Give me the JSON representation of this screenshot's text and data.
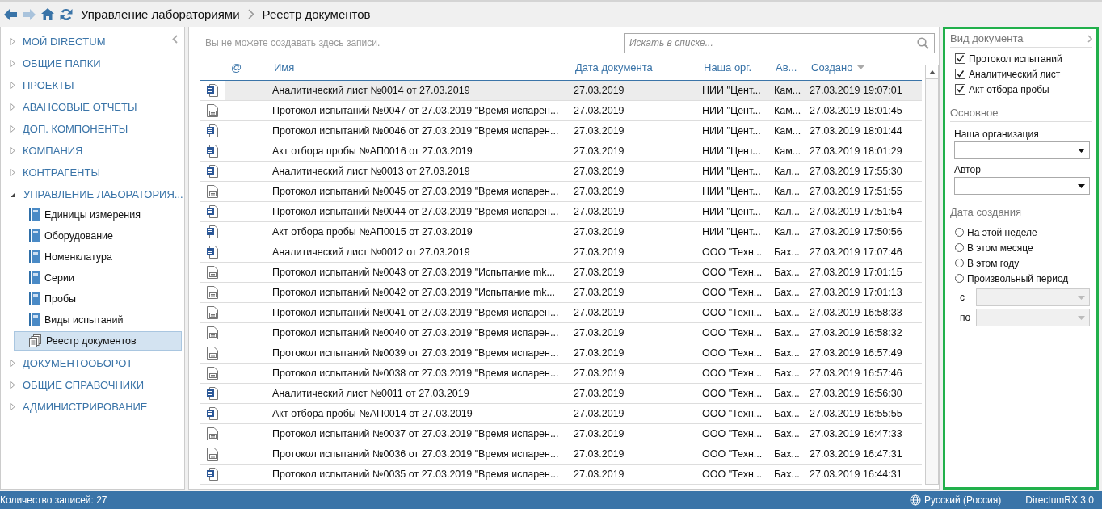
{
  "breadcrumb": [
    "Управление лабораториями",
    "Реестр документов"
  ],
  "sidebar": {
    "items": [
      {
        "label": "МОЙ DIRECTUM",
        "expanded": false
      },
      {
        "label": "ОБЩИЕ ПАПКИ",
        "expanded": false
      },
      {
        "label": "ПРОЕКТЫ",
        "expanded": false
      },
      {
        "label": "АВАНСОВЫЕ ОТЧЕТЫ",
        "expanded": false
      },
      {
        "label": "ДОП. КОМПОНЕНТЫ",
        "expanded": false
      },
      {
        "label": "КОМПАНИЯ",
        "expanded": false
      },
      {
        "label": "КОНТРАГЕНТЫ",
        "expanded": false
      },
      {
        "label": "УПРАВЛЕНИЕ ЛАБОРАТОРИЯ...",
        "expanded": true,
        "children": [
          {
            "label": "Единицы измерения",
            "kind": "book",
            "selected": false
          },
          {
            "label": "Оборудование",
            "kind": "book",
            "selected": false
          },
          {
            "label": "Номенклатура",
            "kind": "book",
            "selected": false
          },
          {
            "label": "Серии",
            "kind": "book",
            "selected": false
          },
          {
            "label": "Пробы",
            "kind": "book",
            "selected": false
          },
          {
            "label": "Виды испытаний",
            "kind": "book",
            "selected": false
          },
          {
            "label": "Реестр документов",
            "kind": "registry",
            "selected": true
          }
        ]
      },
      {
        "label": "ДОКУМЕНТООБОРОТ",
        "expanded": false
      },
      {
        "label": "ОБЩИЕ СПРАВОЧНИКИ",
        "expanded": false
      },
      {
        "label": "АДМИНИСТРИРОВАНИЕ",
        "expanded": false
      }
    ]
  },
  "notice": "Вы не можете создавать здесь записи.",
  "search": {
    "placeholder": "Искать в списке..."
  },
  "table": {
    "columns": [
      "@",
      "Имя",
      "Дата документа",
      "Наша орг.",
      "Ав...",
      "Создано"
    ],
    "rows": [
      {
        "kind": "word",
        "selected": true,
        "name": "Аналитический лист №0014 от 27.03.2019",
        "date": "27.03.2019",
        "org": "НИИ \"Цент...",
        "author": "Кам...",
        "created": "27.03.2019 19:07:01"
      },
      {
        "kind": "text",
        "selected": false,
        "name": "Протокол испытаний №0047 от 27.03.2019 \"Время испарен...",
        "date": "27.03.2019",
        "org": "НИИ \"Цент...",
        "author": "Кам...",
        "created": "27.03.2019 18:01:45"
      },
      {
        "kind": "word",
        "selected": false,
        "name": "Протокол испытаний №0046 от 27.03.2019 \"Время испарен...",
        "date": "27.03.2019",
        "org": "НИИ \"Цент...",
        "author": "Кам...",
        "created": "27.03.2019 18:01:44"
      },
      {
        "kind": "word",
        "selected": false,
        "name": "Акт отбора пробы №АП0016 от 27.03.2019",
        "date": "27.03.2019",
        "org": "НИИ \"Цент...",
        "author": "Кам...",
        "created": "27.03.2019 18:01:29"
      },
      {
        "kind": "word",
        "selected": false,
        "name": "Аналитический лист №0013 от 27.03.2019",
        "date": "27.03.2019",
        "org": "НИИ \"Цент...",
        "author": "Кал...",
        "created": "27.03.2019 17:55:30"
      },
      {
        "kind": "text",
        "selected": false,
        "name": "Протокол испытаний №0045 от 27.03.2019 \"Время испарен...",
        "date": "27.03.2019",
        "org": "НИИ \"Цент...",
        "author": "Кал...",
        "created": "27.03.2019 17:51:55"
      },
      {
        "kind": "word",
        "selected": false,
        "name": "Протокол испытаний №0044 от 27.03.2019 \"Время испарен...",
        "date": "27.03.2019",
        "org": "НИИ \"Цент...",
        "author": "Кал...",
        "created": "27.03.2019 17:51:54"
      },
      {
        "kind": "word",
        "selected": false,
        "name": "Акт отбора пробы №АП0015 от 27.03.2019",
        "date": "27.03.2019",
        "org": "НИИ \"Цент...",
        "author": "Кал...",
        "created": "27.03.2019 17:50:56"
      },
      {
        "kind": "word",
        "selected": false,
        "name": "Аналитический лист №0012 от 27.03.2019",
        "date": "27.03.2019",
        "org": "ООО \"Техн...",
        "author": "Бах...",
        "created": "27.03.2019 17:07:46"
      },
      {
        "kind": "text",
        "selected": false,
        "name": "Протокол испытаний №0043 от 27.03.2019 \"Испытание mk...",
        "date": "27.03.2019",
        "org": "ООО \"Техн...",
        "author": "Бах...",
        "created": "27.03.2019 17:01:15"
      },
      {
        "kind": "text",
        "selected": false,
        "name": "Протокол испытаний №0042 от 27.03.2019 \"Испытание mk...",
        "date": "27.03.2019",
        "org": "ООО \"Техн...",
        "author": "Бах...",
        "created": "27.03.2019 17:01:13"
      },
      {
        "kind": "text",
        "selected": false,
        "name": "Протокол испытаний №0041 от 27.03.2019 \"Время испарен...",
        "date": "27.03.2019",
        "org": "ООО \"Техн...",
        "author": "Бах...",
        "created": "27.03.2019 16:58:33"
      },
      {
        "kind": "text",
        "selected": false,
        "name": "Протокол испытаний №0040 от 27.03.2019 \"Время испарен...",
        "date": "27.03.2019",
        "org": "ООО \"Техн...",
        "author": "Бах...",
        "created": "27.03.2019 16:58:32"
      },
      {
        "kind": "text",
        "selected": false,
        "name": "Протокол испытаний №0039 от 27.03.2019 \"Время испарен...",
        "date": "27.03.2019",
        "org": "ООО \"Техн...",
        "author": "Бах...",
        "created": "27.03.2019 16:57:49"
      },
      {
        "kind": "text",
        "selected": false,
        "name": "Протокол испытаний №0038 от 27.03.2019 \"Время испарен...",
        "date": "27.03.2019",
        "org": "ООО \"Техн...",
        "author": "Бах...",
        "created": "27.03.2019 16:57:46"
      },
      {
        "kind": "word",
        "selected": false,
        "name": "Аналитический лист №0011 от 27.03.2019",
        "date": "27.03.2019",
        "org": "ООО \"Техн...",
        "author": "Бах...",
        "created": "27.03.2019 16:56:30"
      },
      {
        "kind": "word",
        "selected": false,
        "name": "Акт отбора пробы №АП0014 от 27.03.2019",
        "date": "27.03.2019",
        "org": "ООО \"Техн...",
        "author": "Бах...",
        "created": "27.03.2019 16:55:55"
      },
      {
        "kind": "text",
        "selected": false,
        "name": "Протокол испытаний №0037 от 27.03.2019 \"Время испарен...",
        "date": "27.03.2019",
        "org": "ООО \"Техн...",
        "author": "Бах...",
        "created": "27.03.2019 16:47:33"
      },
      {
        "kind": "text",
        "selected": false,
        "name": "Протокол испытаний №0036 от 27.03.2019 \"Время испарен...",
        "date": "27.03.2019",
        "org": "ООО \"Техн...",
        "author": "Бах...",
        "created": "27.03.2019 16:47:31"
      },
      {
        "kind": "word",
        "selected": false,
        "name": "Протокол испытаний №0035 от 27.03.2019 \"Время испарен...",
        "date": "27.03.2019",
        "org": "ООО \"Техн...",
        "author": "Бах...",
        "created": "27.03.2019 16:44:31"
      }
    ]
  },
  "filters": {
    "doc_type": {
      "title": "Вид документа",
      "options": [
        {
          "label": "Протокол испытаний",
          "checked": true
        },
        {
          "label": "Аналитический лист",
          "checked": true
        },
        {
          "label": "Акт отбора пробы",
          "checked": true
        }
      ]
    },
    "main": {
      "title": "Основное",
      "fields": [
        {
          "label": "Наша организация"
        },
        {
          "label": "Автор"
        }
      ]
    },
    "created": {
      "title": "Дата создания",
      "options": [
        {
          "label": "На этой неделе",
          "selected": false
        },
        {
          "label": "В этом месяце",
          "selected": false
        },
        {
          "label": "В этом году",
          "selected": false
        },
        {
          "label": "Произвольный период",
          "selected": false
        }
      ],
      "range": [
        {
          "label": "с",
          "disabled": true
        },
        {
          "label": "по",
          "disabled": true
        }
      ]
    }
  },
  "status_bar": {
    "count": "Количество записей: 27",
    "language": "Русский (Россия)",
    "version": "DirectumRX 3.0"
  }
}
